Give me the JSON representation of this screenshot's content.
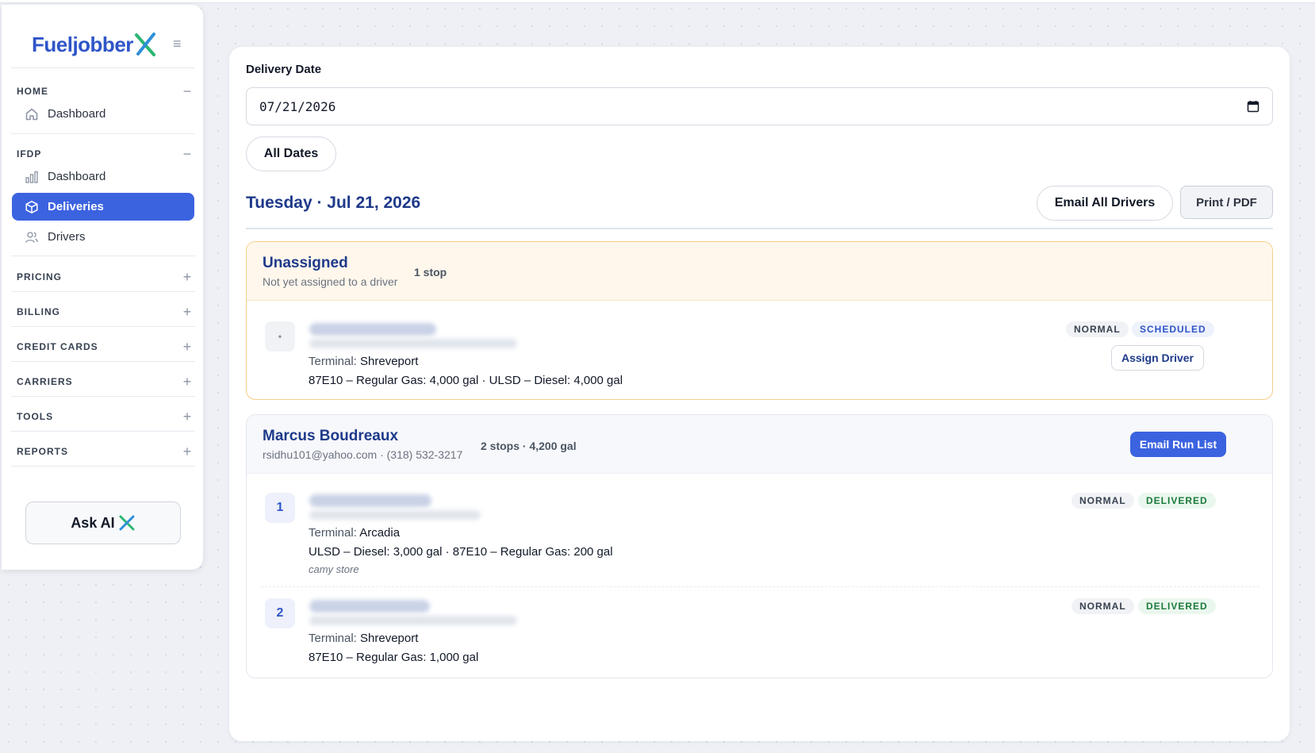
{
  "brand": {
    "name": "Fueljobber",
    "accent_colors": [
      "#2f55c8",
      "#2bb673"
    ]
  },
  "sidebar": {
    "sections": [
      {
        "label": "HOME",
        "toggle": "−",
        "items": [
          {
            "label": "Dashboard",
            "icon": "home-icon"
          }
        ]
      },
      {
        "label": "IFDP",
        "toggle": "−",
        "items": [
          {
            "label": "Dashboard",
            "icon": "bar-chart-icon"
          },
          {
            "label": "Deliveries",
            "icon": "box-icon",
            "active": true
          },
          {
            "label": "Drivers",
            "icon": "users-icon"
          }
        ]
      },
      {
        "label": "PRICING",
        "toggle": "+"
      },
      {
        "label": "BILLING",
        "toggle": "+"
      },
      {
        "label": "CREDIT CARDS",
        "toggle": "+"
      },
      {
        "label": "CARRIERS",
        "toggle": "+"
      },
      {
        "label": "TOOLS",
        "toggle": "+"
      },
      {
        "label": "REPORTS",
        "toggle": "+"
      }
    ],
    "ask_ai_label": "Ask AI"
  },
  "filters": {
    "date_label": "Delivery Date",
    "date_value": "07/21/2026",
    "all_dates_label": "All Dates"
  },
  "day": {
    "title": "Tuesday · Jul 21, 2026",
    "email_all_label": "Email All Drivers",
    "print_label": "Print / PDF"
  },
  "groups": [
    {
      "name": "Unassigned",
      "subtitle": "Not yet assigned to a driver",
      "meta": "1 stop",
      "stops": [
        {
          "number": "•",
          "terminal_label": "Terminal:",
          "terminal": "Shreveport",
          "products": "87E10 – Regular Gas: 4,000 gal  ·  ULSD – Diesel: 4,000 gal",
          "priority": "NORMAL",
          "status": "SCHEDULED",
          "action_label": "Assign Driver"
        }
      ]
    },
    {
      "name": "Marcus Boudreaux",
      "subtitle": "rsidhu101@yahoo.com  ·  (318) 532-3217",
      "meta": "2 stops  ·  4,200 gal",
      "action_label": "Email Run List",
      "stops": [
        {
          "number": "1",
          "terminal_label": "Terminal:",
          "terminal": "Arcadia",
          "products": "ULSD – Diesel: 3,000 gal  ·  87E10 – Regular Gas: 200 gal",
          "note": "camy store",
          "priority": "NORMAL",
          "status": "DELIVERED"
        },
        {
          "number": "2",
          "terminal_label": "Terminal:",
          "terminal": "Shreveport",
          "products": "87E10 – Regular Gas: 1,000 gal",
          "priority": "NORMAL",
          "status": "DELIVERED"
        }
      ]
    }
  ]
}
